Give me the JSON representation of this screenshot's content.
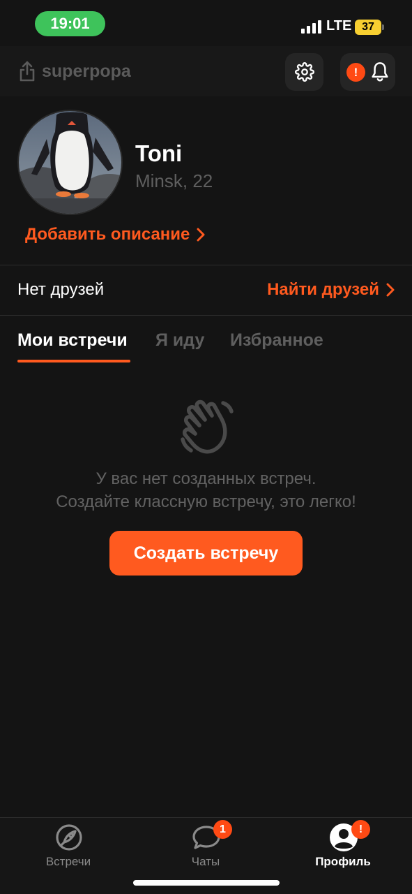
{
  "status_bar": {
    "time": "19:01",
    "network": "LTE",
    "battery": "37"
  },
  "header": {
    "username": "superpopa"
  },
  "alert_badge": "!",
  "profile": {
    "name": "Toni",
    "location_age": "Minsk, 22",
    "add_description": "Добавить описание"
  },
  "friends": {
    "label": "Нет друзей",
    "find_link": "Найти друзей"
  },
  "tabs": [
    {
      "label": "Мои встречи",
      "active": true
    },
    {
      "label": "Я иду",
      "active": false
    },
    {
      "label": "Избранное",
      "active": false
    }
  ],
  "empty_state": {
    "line1": "У вас нет созданных встреч.",
    "line2": "Создайте классную встречу, это легко!",
    "button": "Создать встречу"
  },
  "bottom_nav": [
    {
      "label": "Встречи",
      "icon": "rocket-icon",
      "badge": ""
    },
    {
      "label": "Чаты",
      "icon": "chat-bubble-icon",
      "badge": "1"
    },
    {
      "label": "Профиль",
      "icon": "user-circle-icon",
      "badge": "!",
      "active": true
    }
  ],
  "colors": {
    "accent": "#ff5a1f",
    "background": "#141414",
    "status_green": "#3ec35b",
    "battery": "#f7cf31"
  }
}
